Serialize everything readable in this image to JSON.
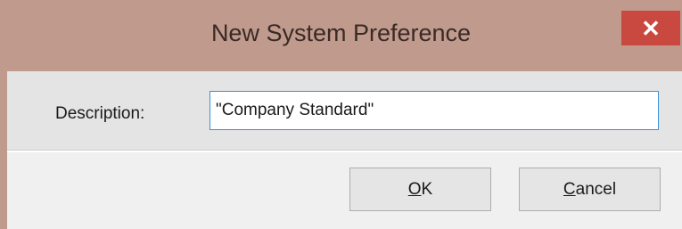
{
  "window": {
    "title": "New System Preference",
    "close_glyph": "✕",
    "close_icon": "close-icon"
  },
  "form": {
    "description_label": "Description:",
    "description_value": "\"Company Standard\""
  },
  "buttons": {
    "ok_accel": "O",
    "ok_rest": "K",
    "cancel_accel": "C",
    "cancel_rest": "ancel"
  },
  "colors": {
    "titlebar": "#c09a8d",
    "close_button": "#c9483f",
    "input_border_focus": "#3c8fd9"
  }
}
